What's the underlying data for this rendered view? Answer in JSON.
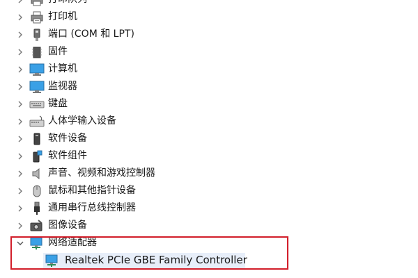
{
  "device_tree": {
    "categories": [
      {
        "label": "打印队列",
        "icon": "print-queue-icon",
        "expanded": false
      },
      {
        "label": "打印机",
        "icon": "printer-icon",
        "expanded": false
      },
      {
        "label": "端口 (COM 和 LPT)",
        "icon": "port-icon",
        "expanded": false
      },
      {
        "label": "固件",
        "icon": "firmware-icon",
        "expanded": false
      },
      {
        "label": "计算机",
        "icon": "computer-icon",
        "expanded": false
      },
      {
        "label": "监视器",
        "icon": "monitor-icon",
        "expanded": false
      },
      {
        "label": "键盘",
        "icon": "keyboard-icon",
        "expanded": false
      },
      {
        "label": "人体学输入设备",
        "icon": "hid-icon",
        "expanded": false
      },
      {
        "label": "软件设备",
        "icon": "software-device-icon",
        "expanded": false
      },
      {
        "label": "软件组件",
        "icon": "software-component-icon",
        "expanded": false
      },
      {
        "label": "声音、视频和游戏控制器",
        "icon": "speaker-icon",
        "expanded": false
      },
      {
        "label": "鼠标和其他指针设备",
        "icon": "mouse-icon",
        "expanded": false
      },
      {
        "label": "通用串行总线控制器",
        "icon": "usb-icon",
        "expanded": false
      },
      {
        "label": "图像设备",
        "icon": "camera-icon",
        "expanded": false
      },
      {
        "label": "网络适配器",
        "icon": "network-adapter-icon",
        "expanded": true,
        "children": [
          {
            "label": "Realtek PCIe GBE Family Controller",
            "icon": "network-adapter-icon"
          }
        ]
      }
    ]
  },
  "colors": {
    "highlight_border": "#d21e2a",
    "selection_bg": "#e7eef9",
    "monitor_blue": "#3aa0e6"
  }
}
